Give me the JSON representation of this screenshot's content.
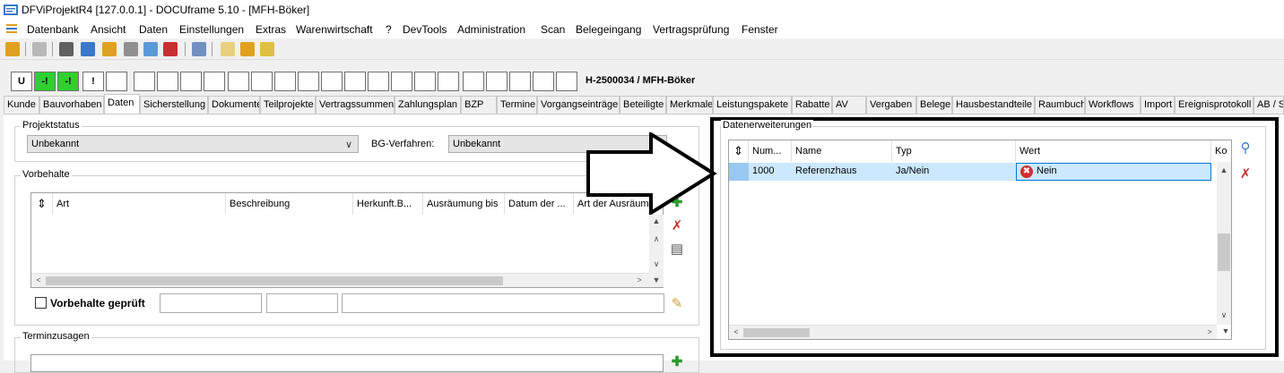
{
  "window": {
    "title": "DFViProjektR4 [127.0.0.1] - DOCUframe 5.10 - [MFH-Böker]"
  },
  "menu": {
    "items": [
      "Datenbank",
      "Ansicht",
      "Daten",
      "Einstellungen",
      "Extras",
      "Warenwirtschaft",
      "?",
      "DevTools",
      "Administration",
      "Scan",
      "Belegeingang",
      "Vertragsprüfung",
      "Fenster"
    ]
  },
  "status_strip": {
    "boxes": [
      "U",
      "-!",
      "-!",
      "!"
    ],
    "project_label": "H-2500034 / MFH-Böker"
  },
  "tabs": {
    "active": "Daten",
    "items": [
      "Kunde",
      "Bauvorhaben",
      "Daten",
      "Sicherstellung",
      "Dokumente",
      "Teilprojekte",
      "Vertragssummen",
      "Zahlungsplan",
      "BZP",
      "Termine",
      "Vorgangseinträge",
      "Beteiligte",
      "Merkmale",
      "Leistungspakete",
      "Rabatte",
      "AV",
      "Vergaben",
      "Belege",
      "Hausbestandteile",
      "Raumbuch",
      "Workflows",
      "Import",
      "Ereignisprotokoll",
      "AB / S"
    ]
  },
  "projektstatus": {
    "group_title": "Projektstatus",
    "status_value": "Unbekannt",
    "bg_label": "BG-Verfahren:",
    "bg_value": "Unbekannt"
  },
  "vorbehalte": {
    "group_title": "Vorbehalte",
    "columns": [
      "Art",
      "Beschreibung",
      "Herkunft.B...",
      "Ausräumung bis",
      "Datum der ...",
      "Art der Ausräumung"
    ],
    "checkbox_label": "Vorbehalte geprüft"
  },
  "terminzusagen": {
    "group_title": "Terminzusagen"
  },
  "datenerweiterungen": {
    "group_title": "Datenerweiterungen",
    "columns": [
      "Num...",
      "Name",
      "Typ",
      "Wert",
      "Ko"
    ],
    "rows": [
      {
        "num": "1000",
        "name": "Referenzhaus",
        "typ": "Ja/Nein",
        "wert": "Nein"
      }
    ]
  },
  "colors": {
    "green_box": "#2fd02f",
    "selected_row": "#cce8ff",
    "highlight_border": "#000000"
  }
}
